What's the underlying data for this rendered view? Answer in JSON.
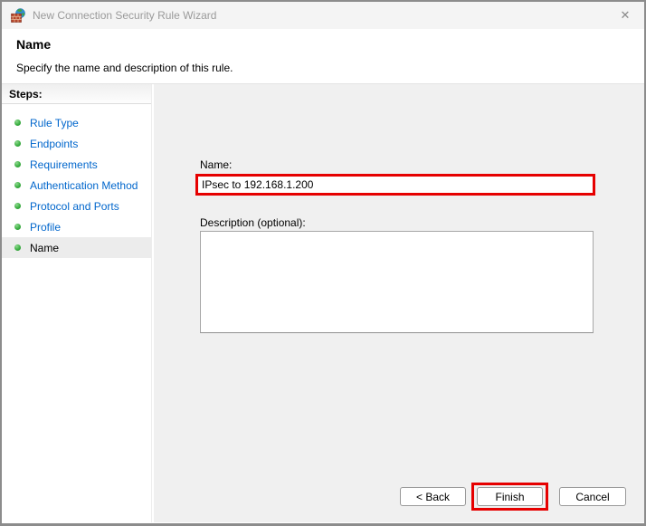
{
  "window": {
    "title": "New Connection Security Rule Wizard",
    "close_icon": "✕"
  },
  "header": {
    "title": "Name",
    "subtitle": "Specify the name and description of this rule."
  },
  "sidebar": {
    "title": "Steps:",
    "items": [
      {
        "label": "Rule Type",
        "active": false
      },
      {
        "label": "Endpoints",
        "active": false
      },
      {
        "label": "Requirements",
        "active": false
      },
      {
        "label": "Authentication Method",
        "active": false
      },
      {
        "label": "Protocol and Ports",
        "active": false
      },
      {
        "label": "Profile",
        "active": false
      },
      {
        "label": "Name",
        "active": true
      }
    ]
  },
  "form": {
    "name_label": "Name:",
    "name_value": "IPsec to 192.168.1.200",
    "description_label": "Description (optional):",
    "description_value": ""
  },
  "buttons": {
    "back": "< Back",
    "finish": "Finish",
    "cancel": "Cancel"
  },
  "colors": {
    "annotation_red": "#e60000",
    "step_link_blue": "#0066cc",
    "step_bullet_green": "#3cb043",
    "main_background": "#f0f0f0",
    "titlebar_text": "#9a9a9a"
  }
}
